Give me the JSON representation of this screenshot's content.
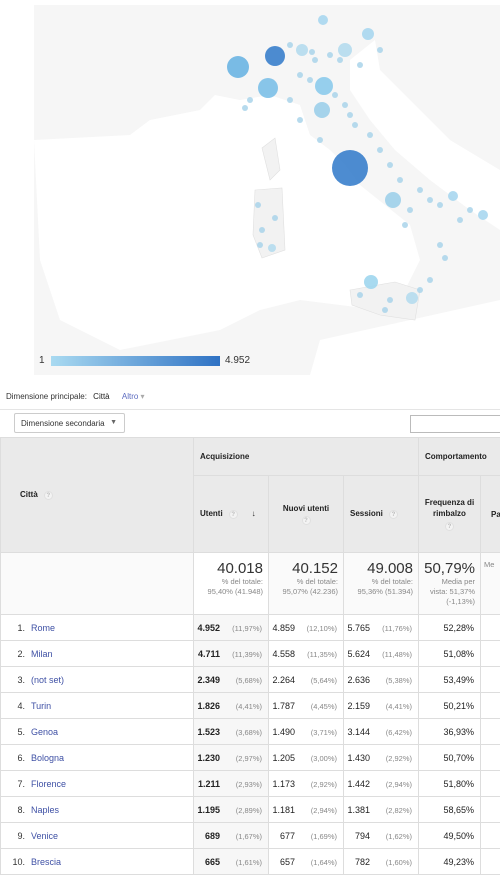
{
  "map": {
    "legend_min": "1",
    "legend_max": "4.952",
    "scale_colors": [
      "#a9daf1",
      "#2f72c4"
    ]
  },
  "dimension": {
    "label": "Dimensione principale:",
    "current": "Città",
    "other": "Altro"
  },
  "secondary_dimension": {
    "label": "Dimensione secondaria"
  },
  "table": {
    "city_header": "Città",
    "group_acquisition": "Acquisizione",
    "group_behavior": "Comportamento",
    "columns": [
      "Utenti",
      "Nuovi utenti",
      "Sessioni",
      "Frequenza di rimbalzo",
      "Pa"
    ],
    "totals": [
      {
        "value": "40.018",
        "l1": "% del totale:",
        "l2": "95,40% (41.948)"
      },
      {
        "value": "40.152",
        "l1": "% del totale:",
        "l2": "95,07% (42.236)"
      },
      {
        "value": "49.008",
        "l1": "% del totale:",
        "l2": "95,36% (51.394)"
      },
      {
        "value": "50,79%",
        "l1": "Media per",
        "l2": "vista: 51,37%",
        "l3": "(-1,13%)"
      },
      {
        "value": "",
        "l1": "Me"
      }
    ],
    "rows": [
      {
        "i": "1.",
        "city": "Rome",
        "u": "4.952",
        "up": "(11,97%)",
        "n": "4.859",
        "np": "(12,10%)",
        "s": "5.765",
        "sp": "(11,76%)",
        "b": "52,28%"
      },
      {
        "i": "2.",
        "city": "Milan",
        "u": "4.711",
        "up": "(11,39%)",
        "n": "4.558",
        "np": "(11,35%)",
        "s": "5.624",
        "sp": "(11,48%)",
        "b": "51,08%"
      },
      {
        "i": "3.",
        "city": "(not set)",
        "u": "2.349",
        "up": "(5,68%)",
        "n": "2.264",
        "np": "(5,64%)",
        "s": "2.636",
        "sp": "(5,38%)",
        "b": "53,49%"
      },
      {
        "i": "4.",
        "city": "Turin",
        "u": "1.826",
        "up": "(4,41%)",
        "n": "1.787",
        "np": "(4,45%)",
        "s": "2.159",
        "sp": "(4,41%)",
        "b": "50,21%"
      },
      {
        "i": "5.",
        "city": "Genoa",
        "u": "1.523",
        "up": "(3,68%)",
        "n": "1.490",
        "np": "(3,71%)",
        "s": "3.144",
        "sp": "(6,42%)",
        "b": "36,93%"
      },
      {
        "i": "6.",
        "city": "Bologna",
        "u": "1.230",
        "up": "(2,97%)",
        "n": "1.205",
        "np": "(3,00%)",
        "s": "1.430",
        "sp": "(2,92%)",
        "b": "50,70%"
      },
      {
        "i": "7.",
        "city": "Florence",
        "u": "1.211",
        "up": "(2,93%)",
        "n": "1.173",
        "np": "(2,92%)",
        "s": "1.442",
        "sp": "(2,94%)",
        "b": "51,80%"
      },
      {
        "i": "8.",
        "city": "Naples",
        "u": "1.195",
        "up": "(2,89%)",
        "n": "1.181",
        "np": "(2,94%)",
        "s": "1.381",
        "sp": "(2,82%)",
        "b": "58,65%"
      },
      {
        "i": "9.",
        "city": "Venice",
        "u": "689",
        "up": "(1,67%)",
        "n": "677",
        "np": "(1,69%)",
        "s": "794",
        "sp": "(1,62%)",
        "b": "49,50%"
      },
      {
        "i": "10.",
        "city": "Brescia",
        "u": "665",
        "up": "(1,61%)",
        "n": "657",
        "np": "(1,64%)",
        "s": "782",
        "sp": "(1,60%)",
        "b": "49,23%"
      }
    ]
  }
}
